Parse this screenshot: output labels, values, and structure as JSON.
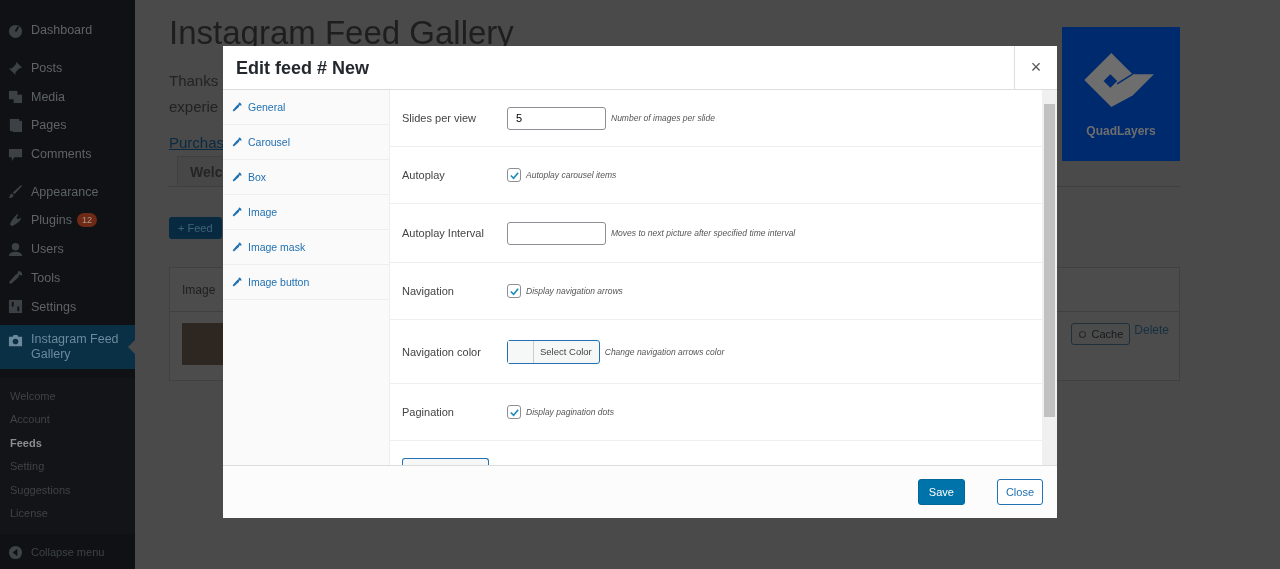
{
  "sidebar": {
    "groups": [
      [
        {
          "label": "Dashboard",
          "selected": false
        }
      ],
      [
        {
          "label": "Posts",
          "selected": false
        },
        {
          "label": "Media",
          "selected": false
        },
        {
          "label": "Pages",
          "selected": false
        },
        {
          "label": "Comments",
          "selected": false
        }
      ],
      [
        {
          "label": "Appearance",
          "selected": false
        },
        {
          "label": "Plugins",
          "badge": "12",
          "selected": false
        },
        {
          "label": "Users",
          "selected": false
        },
        {
          "label": "Tools",
          "selected": false
        },
        {
          "label": "Settings",
          "selected": false
        },
        {
          "label": "Instagram Feed Gallery",
          "selected": true
        }
      ]
    ],
    "submenu": [
      {
        "label": "Welcome",
        "selected": false
      },
      {
        "label": "Account",
        "selected": false
      },
      {
        "label": "Feeds",
        "selected": true
      },
      {
        "label": "Setting",
        "selected": false
      },
      {
        "label": "Suggestions",
        "selected": false
      },
      {
        "label": "License",
        "selected": false
      }
    ],
    "collapse": "Collapse menu"
  },
  "page": {
    "title": "Instagram Feed Gallery",
    "intro_lines": [
      "Thanks",
      "experie"
    ],
    "link": "Purchas",
    "tab": "Welc",
    "add_button": "+ Feed",
    "logo_text": "QuadLayers",
    "table": {
      "column": "Image",
      "cache_button": "Cache",
      "delete_link": "Delete"
    }
  },
  "modal": {
    "title": "Edit feed # New",
    "close": "×",
    "nav": [
      "General",
      "Carousel",
      "Box",
      "Image",
      "Image mask",
      "Image button"
    ],
    "fields": [
      {
        "kind": "text",
        "label": "Slides per view",
        "value": "5",
        "help": "Number of images per slide"
      },
      {
        "kind": "checkbox",
        "label": "Autoplay",
        "checked": true,
        "help": "Autoplay carousel items"
      },
      {
        "kind": "text",
        "label": "Autoplay Interval",
        "help": "Moves to next picture after specified time interval"
      },
      {
        "kind": "checkbox",
        "label": "Navigation",
        "checked": true,
        "help": "Display navigation arrows"
      },
      {
        "kind": "color",
        "label": "Navigation color",
        "button": "Select Color",
        "help": "Change navigation arrows color"
      },
      {
        "kind": "checkbox",
        "label": "Pagination",
        "checked": true,
        "help": "Display pagination dots"
      },
      {
        "kind": "color-partial"
      }
    ],
    "save": "Save",
    "cancel": "Close"
  }
}
